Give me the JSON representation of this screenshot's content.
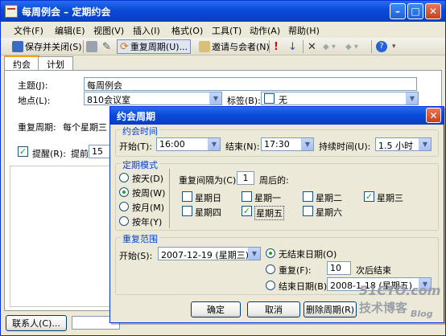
{
  "window": {
    "title": "每周例会 – 定期约会"
  },
  "menu": [
    "文件(F)",
    "编辑(E)",
    "视图(V)",
    "插入(I)",
    "格式(O)",
    "工具(T)",
    "动作(A)",
    "帮助(H)"
  ],
  "toolbar": {
    "save_close": "保存并关闭(S)",
    "recurrence": "重复周期(U)...",
    "invite": "邀请与会者(N)"
  },
  "tabs": [
    "约会",
    "计划"
  ],
  "form": {
    "subject_label": "主题(J):",
    "subject_value": "每周例会",
    "location_label": "地点(L):",
    "location_value": "810会议室",
    "tag_label": "标签(B):",
    "tag_value": "无",
    "recur_label": "重复周期:",
    "recur_value": "每个星期三",
    "reminder_label": "提醒(R):",
    "reminder_prefix": "提前",
    "reminder_value": "15"
  },
  "status": {
    "contacts_button": "联系人(C)..."
  },
  "dialog": {
    "title": "约会周期",
    "time_group": "约会时间",
    "start_label": "开始(T):",
    "start_value": "16:00",
    "end_label": "结束(N):",
    "end_value": "17:30",
    "duration_label": "持续时间(U):",
    "duration_value": "1.5 小时",
    "pattern_group": "定期模式",
    "daily": "按天(D)",
    "weekly": "按周(W)",
    "monthly": "按月(M)",
    "yearly": "按年(Y)",
    "interval_prefix": "重复间隔为(C)",
    "interval_value": "1",
    "interval_suffix": "周后的:",
    "days": [
      "星期日",
      "星期一",
      "星期二",
      "星期三",
      "星期四",
      "星期五",
      "星期六"
    ],
    "range_group": "重复范围",
    "range_start_label": "开始(S):",
    "range_start_value": "2007-12-19 (星期三)",
    "no_end": "无结束日期(O)",
    "repeat_label": "重复(F):",
    "repeat_value": "10",
    "repeat_suffix": "次后结束",
    "end_date_label": "结束日期(B):",
    "end_date_value": "2008-1-18 (星期五)",
    "ok": "确定",
    "cancel": "取消",
    "remove": "删除周期(R)"
  },
  "watermark": {
    "line1": "51CTO.com",
    "line2": "技术博客",
    "line3": "Blog"
  }
}
